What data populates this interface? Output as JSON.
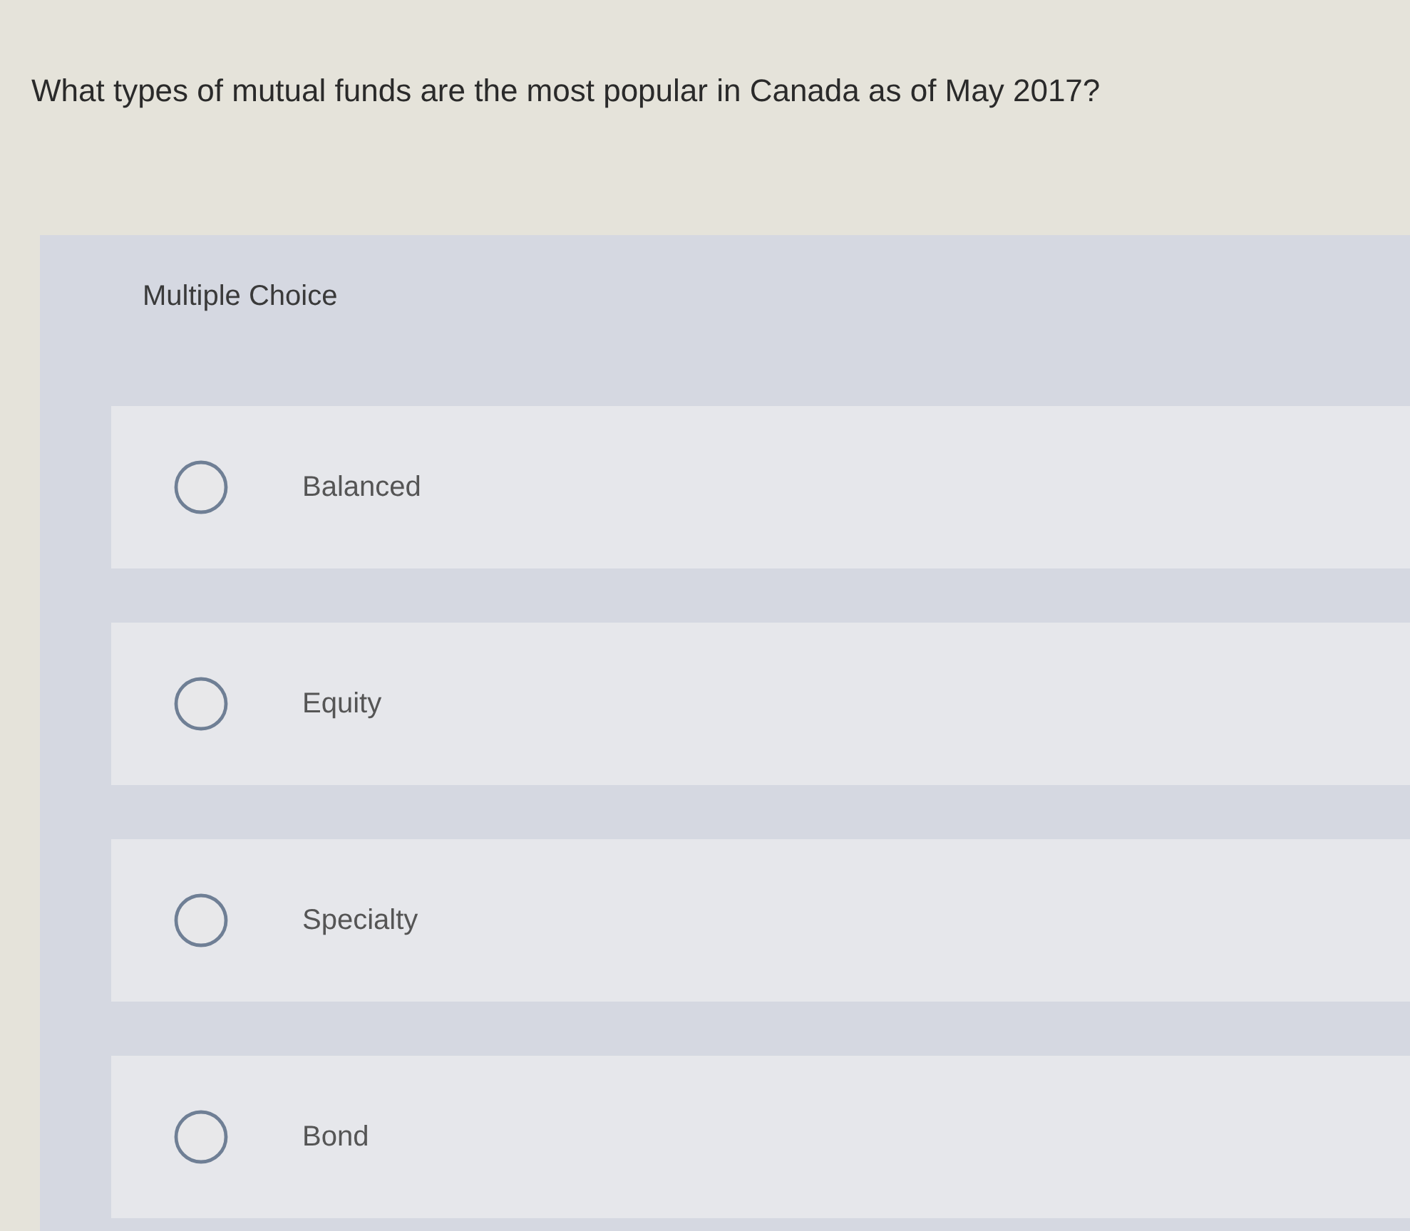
{
  "question": "What types of mutual funds are the most popular in Canada as of May 2017?",
  "panel": {
    "label": "Multiple Choice"
  },
  "options": [
    {
      "label": "Balanced",
      "selected": false
    },
    {
      "label": "Equity",
      "selected": false
    },
    {
      "label": "Specialty",
      "selected": false
    },
    {
      "label": "Bond",
      "selected": false
    }
  ]
}
